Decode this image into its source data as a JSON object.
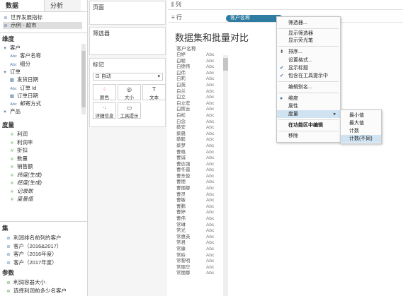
{
  "left_pane": {
    "tabs": [
      "数据",
      "分析"
    ],
    "sources": [
      "世界发展指标",
      "示例 - 超市"
    ],
    "dimensions_title": "维度",
    "dimensions": [
      {
        "label": "客户",
        "kind": "folder"
      },
      {
        "label": "客户名称",
        "kind": "abc"
      },
      {
        "label": "细分",
        "kind": "abc"
      },
      {
        "label": "订单",
        "kind": "folder"
      },
      {
        "label": "发货日期",
        "kind": "date"
      },
      {
        "label": "订单 Id",
        "kind": "abc"
      },
      {
        "label": "订单日期",
        "kind": "date"
      },
      {
        "label": "邮寄方式",
        "kind": "abc"
      },
      {
        "label": "产品",
        "kind": "folder"
      }
    ],
    "measures_title": "度量",
    "measures": [
      {
        "label": "利润",
        "italic": false
      },
      {
        "label": "利润率",
        "italic": false
      },
      {
        "label": "折扣",
        "italic": false
      },
      {
        "label": "数量",
        "italic": false
      },
      {
        "label": "销售额",
        "italic": false
      },
      {
        "label": "纬度(生成)",
        "italic": true
      },
      {
        "label": "经度(生成)",
        "italic": true
      },
      {
        "label": "记录数",
        "italic": true
      },
      {
        "label": "度量值",
        "italic": true
      }
    ],
    "sets_title": "集",
    "sets": [
      "利润排名前列的客户",
      "客户（2016&2017）",
      "客户（2016年度）",
      "客户（2017年度）"
    ],
    "params_title": "参数",
    "params": [
      "利润容器大小",
      "选择利润前多少名客户"
    ]
  },
  "shelves": {
    "pages_title": "页面",
    "filters_title": "筛选器",
    "marks_title": "标记",
    "mark_type": "自动",
    "mark_buttons": [
      {
        "label": "颜色",
        "icon": "color-icon",
        "glyph": "⁘"
      },
      {
        "label": "大小",
        "icon": "size-icon",
        "glyph": "◎"
      },
      {
        "label": "文本",
        "icon": "text-icon",
        "glyph": "T"
      },
      {
        "label": "详细信息",
        "icon": "detail-icon",
        "glyph": "⁖"
      },
      {
        "label": "工具提示",
        "icon": "tooltip-icon",
        "glyph": "▭"
      }
    ]
  },
  "view": {
    "columns_label": "列",
    "rows_label": "行",
    "row_pill": "客户名称",
    "title": "数据集和批量对比",
    "column_header": "客户名称",
    "cell_value": "Abc",
    "customers": [
      "白婷",
      "白聪",
      "白德伟",
      "白伟",
      "白莉",
      "白苑",
      "白兰",
      "白立",
      "白立宏",
      "白斯云",
      "白松",
      "白念",
      "蔡安",
      "蔡晨",
      "蔡毅",
      "蔡梦",
      "曹格",
      "曹诚",
      "曹达强",
      "曹冬霞",
      "曹东俊",
      "曹丽",
      "曹丽娜",
      "曹灵",
      "曹敏",
      "曹鹏",
      "曹婷",
      "曹伟",
      "常琳",
      "常光",
      "常惠英",
      "常君",
      "常康",
      "常岭",
      "常黎明",
      "常丽华",
      "常丽娜"
    ]
  },
  "context_menu": {
    "items": [
      "筛选器...",
      "显示筛选器",
      "显示荧光笔",
      "排序...",
      "设置格式...",
      "显示标题",
      "包含在工具提示中",
      "编辑别名...",
      "维度",
      "属性",
      "度量",
      "在功能区中编辑",
      "移除"
    ],
    "submenu": [
      "最小值",
      "最大值",
      "计数",
      "计数(不同)"
    ]
  },
  "colors": {
    "pill": "#2e7ca1",
    "dimension": "#4e79a7",
    "measure": "#59a14f",
    "highlight": "#cfe3f3"
  }
}
